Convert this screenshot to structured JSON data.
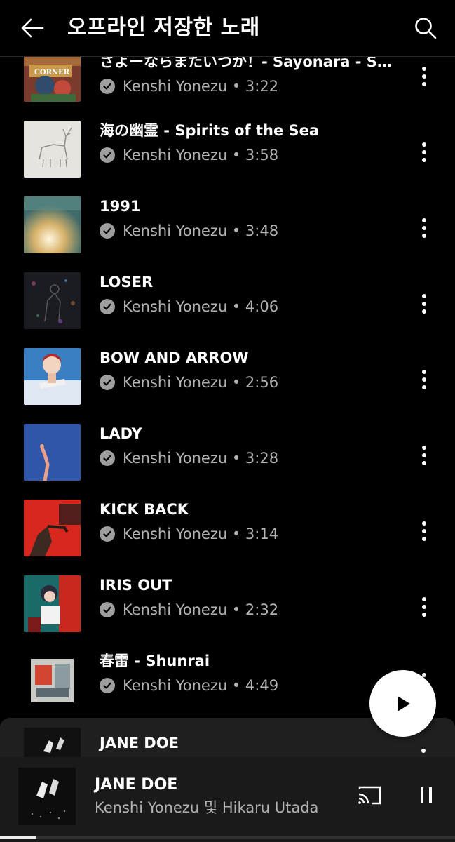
{
  "header": {
    "title": "오프라인 저장한 노래",
    "back_icon": "arrow-left-icon",
    "search_icon": "search-icon"
  },
  "songs": [
    {
      "title": "さよーならまたいつか！- Sayonara - Sa...",
      "artist": "Kenshi Yonezu",
      "duration": "3:22"
    },
    {
      "title": "海の幽霊 - Spirits of the Sea",
      "artist": "Kenshi Yonezu",
      "duration": "3:58"
    },
    {
      "title": "1991",
      "artist": "Kenshi Yonezu",
      "duration": "3:48"
    },
    {
      "title": "LOSER",
      "artist": "Kenshi Yonezu",
      "duration": "4:06"
    },
    {
      "title": "BOW AND ARROW",
      "artist": "Kenshi Yonezu",
      "duration": "2:56"
    },
    {
      "title": "LADY",
      "artist": "Kenshi Yonezu",
      "duration": "3:28"
    },
    {
      "title": "KICK BACK",
      "artist": "Kenshi Yonezu",
      "duration": "3:14"
    },
    {
      "title": "IRIS OUT",
      "artist": "Kenshi Yonezu",
      "duration": "2:32"
    },
    {
      "title": "春雷 - Shunrai",
      "artist": "Kenshi Yonezu",
      "duration": "4:49"
    }
  ],
  "peek_song": {
    "title": "JANE DOE"
  },
  "now_playing": {
    "title": "JANE DOE",
    "artist": "Kenshi Yonezu 및 Hikaru Utada",
    "progress": 0.08
  },
  "icons": {
    "downloaded": "check-circle-icon",
    "more": "more-vert-icon",
    "play": "play-icon",
    "cast": "cast-icon",
    "pause": "pause-icon"
  },
  "colors": {
    "background": "#000000",
    "secondary_text": "#b3b3b3",
    "player_background": "#1f1f1f"
  }
}
